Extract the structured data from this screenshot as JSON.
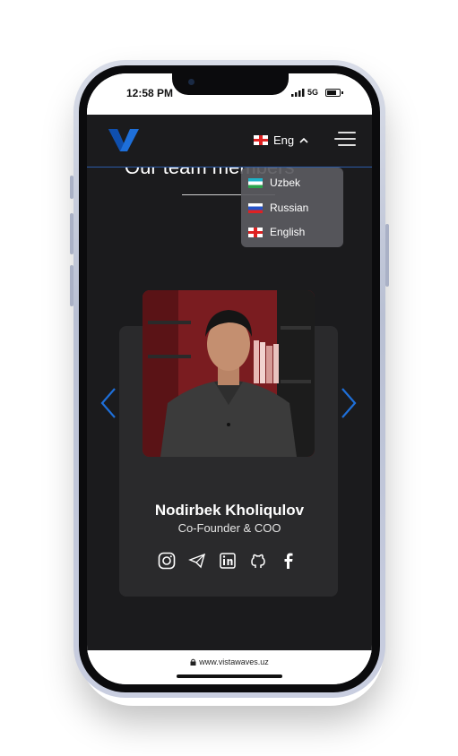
{
  "status_bar": {
    "time": "12:58 PM",
    "network": "5G"
  },
  "navbar": {
    "logo_letter": "V",
    "language_label": "Eng",
    "accent_color": "#1e6fd9"
  },
  "section": {
    "title": "Our team members"
  },
  "language_menu": {
    "items": [
      {
        "label": "Uzbek",
        "flag": "uz-flag-icon"
      },
      {
        "label": "Russian",
        "flag": "ru-flag-icon"
      },
      {
        "label": "English",
        "flag": "en-flag-icon"
      }
    ]
  },
  "team_card": {
    "name": "Nodirbek Kholiqulov",
    "role": "Co-Founder & COO",
    "socials": [
      "instagram-icon",
      "telegram-icon",
      "linkedin-icon",
      "github-icon",
      "facebook-icon"
    ]
  },
  "browser": {
    "url": "www.vistawaves.uz"
  }
}
